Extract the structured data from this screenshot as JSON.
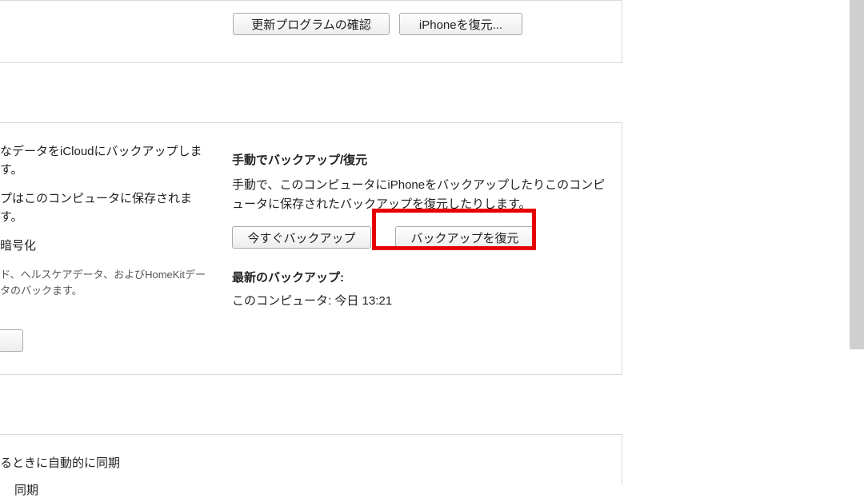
{
  "top_panel": {
    "check_updates_label": "更新プログラムの確認",
    "restore_iphone_label": "iPhoneを復元..."
  },
  "backup_panel": {
    "left": {
      "icloud_text": "なデータをiCloudにバックアップします。",
      "local_text": "プはこのコンピュータに保存されます。",
      "encrypt_heading": "暗号化",
      "encrypt_desc": "ド、ヘルスケアデータ、およびHomeKitデータのバックます。"
    },
    "right": {
      "manual_heading": "手動でバックアップ/復元",
      "manual_desc": "手動で、このコンピュータにiPhoneをバックアップしたりこのコンピュータに保存されたバックアップを復元したりします。",
      "backup_now_label": "今すぐバックアップ",
      "restore_backup_label": "バックアップを復元",
      "latest_heading": "最新のバックアップ:",
      "latest_value": "このコンピュータ: 今日 13:21"
    }
  },
  "sync_panel": {
    "auto_sync_text": "るときに自動的に同期",
    "stub_text": "同期"
  }
}
